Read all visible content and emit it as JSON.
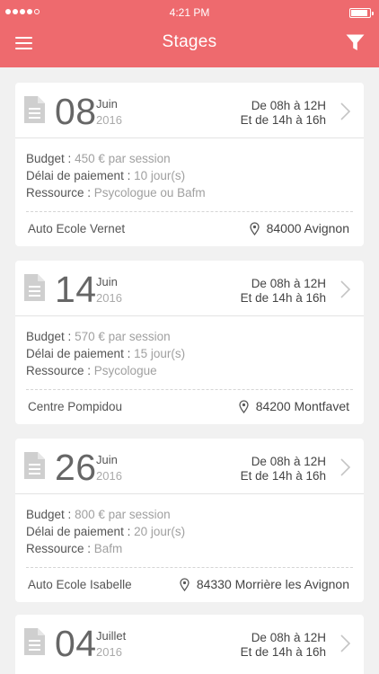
{
  "status": {
    "time": "4:21 PM"
  },
  "header": {
    "title": "Stages"
  },
  "labels": {
    "budget": "Budget :",
    "delai": "Délai de paiement :",
    "ressource": "Ressource :"
  },
  "cards": [
    {
      "day": "08",
      "month": "Juin",
      "year": "2016",
      "hours1": "De 08h à 12H",
      "hours2": "Et de 14h à 16h",
      "budget": "450 € par session",
      "delai": "10 jour(s)",
      "ressource": "Psycologue ou Bafm",
      "place": "Auto Ecole Vernet",
      "location": "84000 Avignon"
    },
    {
      "day": "14",
      "month": "Juin",
      "year": "2016",
      "hours1": "De 08h à 12H",
      "hours2": "Et de 14h à 16h",
      "budget": "570 € par session",
      "delai": "15 jour(s)",
      "ressource": "Psycologue",
      "place": "Centre Pompidou",
      "location": "84200 Montfavet"
    },
    {
      "day": "26",
      "month": "Juin",
      "year": "2016",
      "hours1": "De 08h à 12H",
      "hours2": "Et de 14h à 16h",
      "budget": "800 € par session",
      "delai": "20 jour(s)",
      "ressource": "Bafm",
      "place": "Auto Ecole Isabelle",
      "location": "84330 Morrière les Avignon"
    },
    {
      "day": "04",
      "month": "Juillet",
      "year": "2016",
      "hours1": "De 08h à 12H",
      "hours2": "Et de 14h à 16h"
    }
  ]
}
